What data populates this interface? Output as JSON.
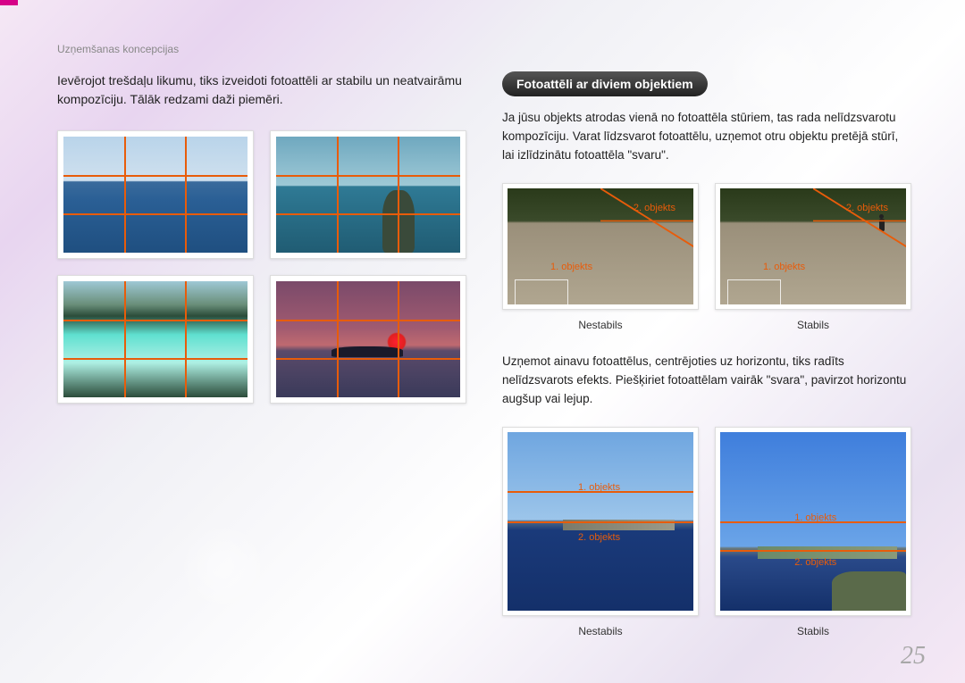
{
  "header": {
    "breadcrumb": "Uzņemšanas koncepcijas"
  },
  "left": {
    "intro": "Ievērojot trešdaļu likumu, tiks izveidoti fotoattēli ar stabilu un neatvairāmu kompozīciju. Tālāk redzami daži piemēri."
  },
  "right": {
    "section_title": "Fotoattēli ar diviem objektiem",
    "para1": "Ja jūsu objekts atrodas vienā no fotoattēla stūriem, tas rada nelīdzsvarotu kompozīciju. Varat līdzsvarot fotoattēlu, uzņemot otru objektu pretējā stūrī, lai izlīdzinātu fotoattēla \"svaru\".",
    "para2": "Uzņemot ainavu fotoattēlus, centrējoties uz horizontu, tiks radīts nelīdzsvarots efekts. Piešķiriet fotoattēlam vairāk \"svara\", pavirzot horizontu augšup vai lejup.",
    "labels": {
      "obj1": "1. objekts",
      "obj2": "2. objekts",
      "unstable": "Nestabils",
      "stable": "Stabils"
    }
  },
  "page_number": "25"
}
